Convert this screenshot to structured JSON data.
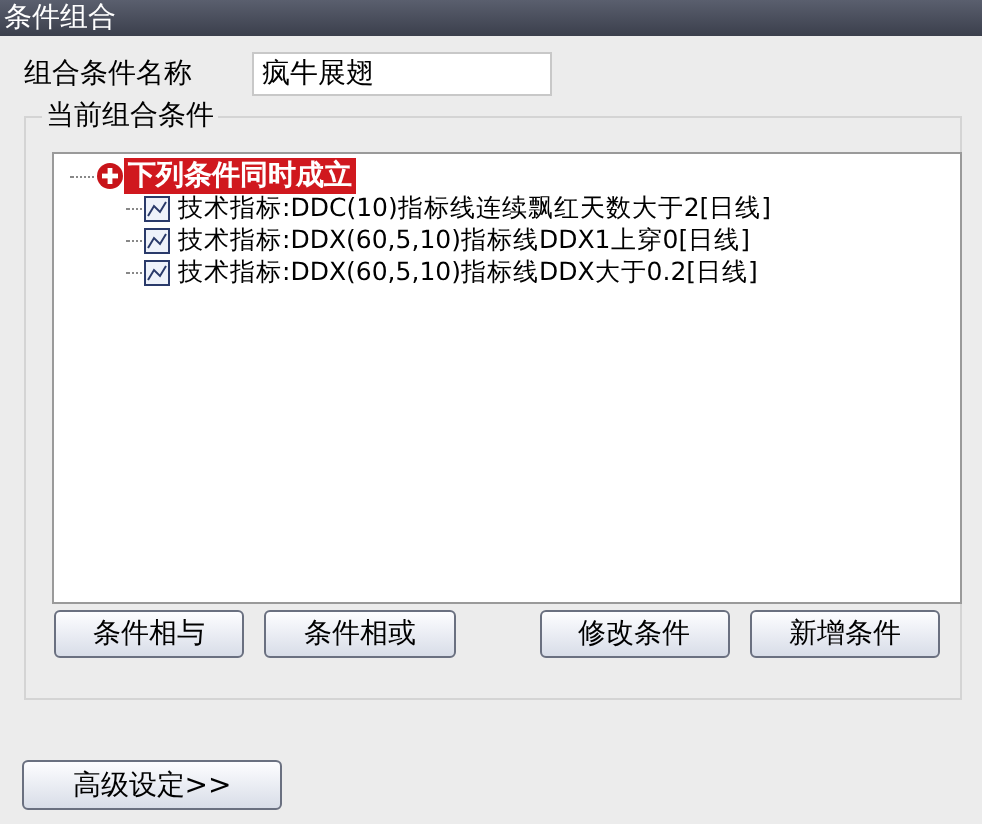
{
  "window": {
    "title": "条件组合"
  },
  "name_field": {
    "label": "组合条件名称",
    "value": "疯牛展翅"
  },
  "group": {
    "title": "当前组合条件"
  },
  "tree": {
    "label": "下列条件同时成立",
    "selected": true,
    "children": [
      {
        "label": "技术指标:DDC(10)指标线连续飘红天数大于2[日线]"
      },
      {
        "label": "技术指标:DDX(60,5,10)指标线DDX1上穿0[日线]"
      },
      {
        "label": "技术指标:DDX(60,5,10)指标线DDX大于0.2[日线]"
      }
    ]
  },
  "buttons": [
    "条件相与",
    "条件相或",
    "修改条件",
    "新增条件"
  ],
  "advanced_button": "高级设定>>"
}
